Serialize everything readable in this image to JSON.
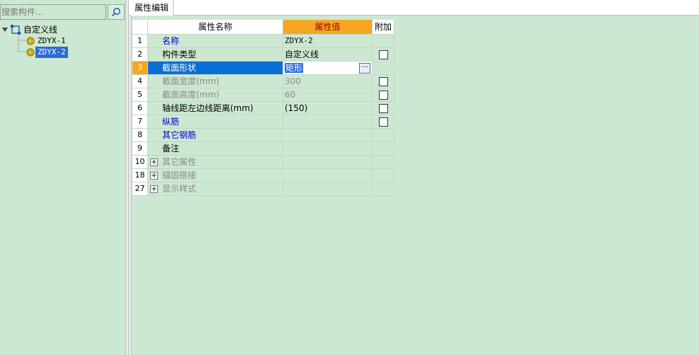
{
  "left_panel": {
    "search_placeholder": "搜索构件...",
    "tree": {
      "root_label": "自定义线",
      "children": [
        {
          "label": "ZDYX-1"
        },
        {
          "label": "ZDYX-2"
        }
      ]
    }
  },
  "right_panel": {
    "tab_label": "属性编辑",
    "grid": {
      "headers": {
        "name": "属性名称",
        "value": "属性值",
        "add": "附加"
      },
      "rows": [
        {
          "num": "1",
          "name": "名称",
          "value": "ZDYX-2"
        },
        {
          "num": "2",
          "name": "构件类型",
          "value": "自定义线"
        },
        {
          "num": "3",
          "name": "截面形状",
          "value": "矩形"
        },
        {
          "num": "4",
          "name": "截面宽度(mm)",
          "value": "300"
        },
        {
          "num": "5",
          "name": "截面高度(mm)",
          "value": "60"
        },
        {
          "num": "6",
          "name": "轴线距左边线距离(mm)",
          "value": "(150)"
        },
        {
          "num": "7",
          "name": "纵筋",
          "value": ""
        },
        {
          "num": "8",
          "name": "其它钢筋",
          "value": ""
        },
        {
          "num": "9",
          "name": "备注",
          "value": ""
        },
        {
          "num": "10",
          "name": "其它属性",
          "value": ""
        },
        {
          "num": "18",
          "name": "锚固搭接",
          "value": ""
        },
        {
          "num": "27",
          "name": "显示样式",
          "value": ""
        }
      ],
      "ellipsis_label": "···"
    }
  },
  "colors": {
    "background": "#cde8d2",
    "selection_blue": "#0a6fd4",
    "header_orange": "#f5a623",
    "link_blue": "#0000cc"
  }
}
